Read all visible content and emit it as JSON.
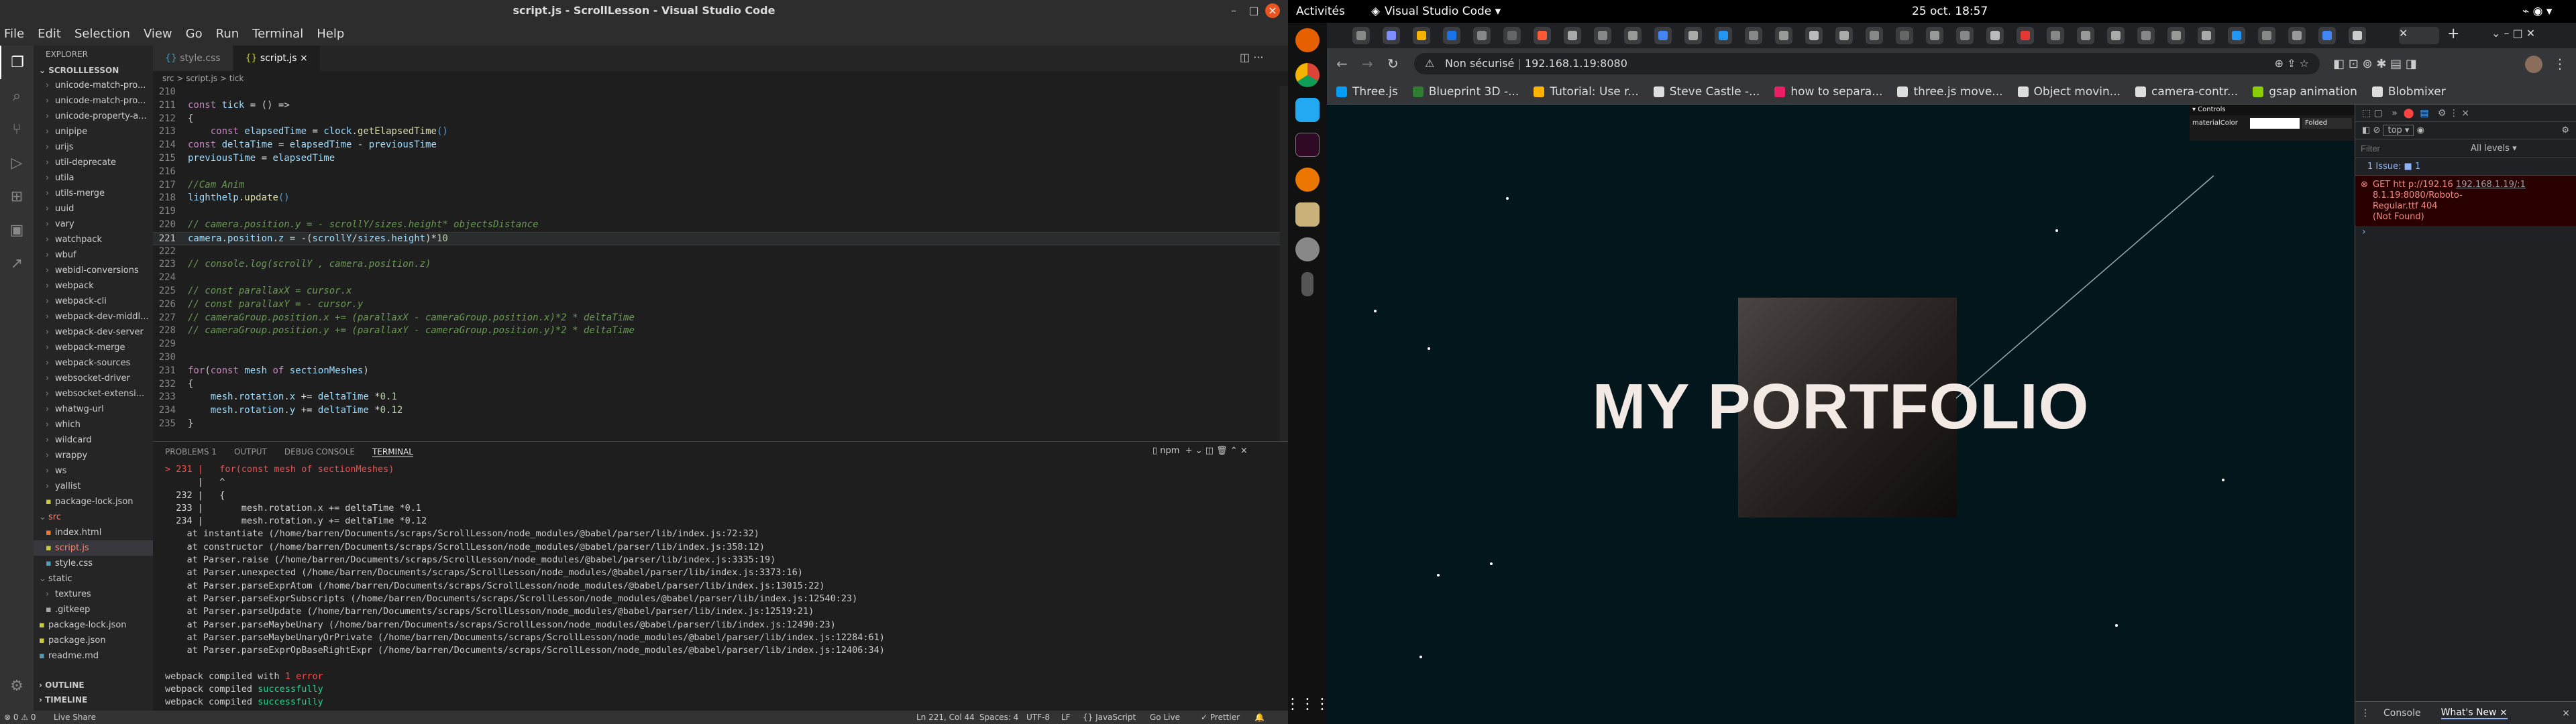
{
  "vscode": {
    "window_title": "script.js - ScrollLesson - Visual Studio Code",
    "menu": [
      "File",
      "Edit",
      "Selection",
      "View",
      "Go",
      "Run",
      "Terminal",
      "Help"
    ],
    "explorer": {
      "header": "EXPLORER",
      "project": "SCROLLLESSON",
      "tree": [
        {
          "t": "unicode-match-pro...",
          "d": 1
        },
        {
          "t": "unicode-match-pro...",
          "d": 1
        },
        {
          "t": "unicode-property-a...",
          "d": 1
        },
        {
          "t": "unipipe",
          "d": 1
        },
        {
          "t": "urijs",
          "d": 1
        },
        {
          "t": "util-deprecate",
          "d": 1
        },
        {
          "t": "utila",
          "d": 1
        },
        {
          "t": "utils-merge",
          "d": 1
        },
        {
          "t": "uuid",
          "d": 1
        },
        {
          "t": "vary",
          "d": 1
        },
        {
          "t": "watchpack",
          "d": 1
        },
        {
          "t": "wbuf",
          "d": 1
        },
        {
          "t": "webidl-conversions",
          "d": 1
        },
        {
          "t": "webpack",
          "d": 1
        },
        {
          "t": "webpack-cli",
          "d": 1
        },
        {
          "t": "webpack-dev-middl...",
          "d": 1
        },
        {
          "t": "webpack-dev-server",
          "d": 1
        },
        {
          "t": "webpack-merge",
          "d": 1
        },
        {
          "t": "webpack-sources",
          "d": 1
        },
        {
          "t": "websocket-driver",
          "d": 1
        },
        {
          "t": "websocket-extensi...",
          "d": 1
        },
        {
          "t": "whatwg-url",
          "d": 1
        },
        {
          "t": "which",
          "d": 1
        },
        {
          "t": "wildcard",
          "d": 1
        },
        {
          "t": "wrappy",
          "d": 1
        },
        {
          "t": "ws",
          "d": 1
        },
        {
          "t": "yallist",
          "d": 1
        },
        {
          "t": "package-lock.json",
          "d": 1,
          "f": "json"
        },
        {
          "t": "src",
          "d": 0,
          "red": true,
          "open": true
        },
        {
          "t": "index.html",
          "d": 1,
          "f": "html"
        },
        {
          "t": "script.js",
          "d": 1,
          "f": "js",
          "red": true,
          "sel": true
        },
        {
          "t": "style.css",
          "d": 1,
          "f": "css"
        },
        {
          "t": "static",
          "d": 0,
          "open": true
        },
        {
          "t": "textures",
          "d": 1
        },
        {
          "t": ".gitkeep",
          "d": 1,
          "f": "txt"
        },
        {
          "t": "package-lock.json",
          "d": 0,
          "f": "json"
        },
        {
          "t": "package.json",
          "d": 0,
          "f": "json"
        },
        {
          "t": "readme.md",
          "d": 0,
          "f": "md"
        }
      ],
      "outline": "OUTLINE",
      "timeline": "TIMELINE"
    },
    "tabs": [
      {
        "label": "style.css",
        "active": false
      },
      {
        "label": "script.js",
        "active": true
      }
    ],
    "breadcrumb": "src > script.js > tick",
    "code_start_line": 210,
    "code": [
      "",
      "const tick = () =>",
      "{",
      "    const elapsedTime = clock.getElapsedTime()",
      "const deltaTime = elapsedTime - previousTime",
      "previousTime = elapsedTime",
      "",
      "//Cam Anim",
      "lighthelp.update()",
      "",
      "// camera.position.y = - scrollY/sizes.height* objectsDistance",
      "camera.position.z = -(scrollY/sizes.height)*10",
      "",
      "// console.log(scrollY , camera.position.z)",
      "",
      "// const parallaxX = cursor.x",
      "// const parallaxY = - cursor.y",
      "// cameraGroup.position.x += (parallaxX - cameraGroup.position.x)*2 * deltaTime",
      "// cameraGroup.position.y += (parallaxY - cameraGroup.position.y)*2 * deltaTime",
      "",
      "",
      "for(const mesh of sectionMeshes)",
      "{",
      "    mesh.rotation.x += deltaTime *0.1",
      "    mesh.rotation.y += deltaTime *0.12",
      "}"
    ],
    "current_line": 221,
    "panel_tabs": [
      "PROBLEMS 1",
      "OUTPUT",
      "DEBUG CONSOLE",
      "TERMINAL"
    ],
    "terminal_shell": "npm",
    "terminal": [
      "> 231 |   for(const mesh of sectionMeshes)",
      "      |   ^",
      "  232 |   {",
      "  233 |       mesh.rotation.x += deltaTime *0.1",
      "  234 |       mesh.rotation.y += deltaTime *0.12",
      "    at instantiate (/home/barren/Documents/scraps/ScrollLesson/node_modules/@babel/parser/lib/index.js:72:32)",
      "    at constructor (/home/barren/Documents/scraps/ScrollLesson/node_modules/@babel/parser/lib/index.js:358:12)",
      "    at Parser.raise (/home/barren/Documents/scraps/ScrollLesson/node_modules/@babel/parser/lib/index.js:3335:19)",
      "    at Parser.unexpected (/home/barren/Documents/scraps/ScrollLesson/node_modules/@babel/parser/lib/index.js:3373:16)",
      "    at Parser.parseExprAtom (/home/barren/Documents/scraps/ScrollLesson/node_modules/@babel/parser/lib/index.js:13015:22)",
      "    at Parser.parseExprSubscripts (/home/barren/Documents/scraps/ScrollLesson/node_modules/@babel/parser/lib/index.js:12540:23)",
      "    at Parser.parseUpdate (/home/barren/Documents/scraps/ScrollLesson/node_modules/@babel/parser/lib/index.js:12519:21)",
      "    at Parser.parseMaybeUnary (/home/barren/Documents/scraps/ScrollLesson/node_modules/@babel/parser/lib/index.js:12490:23)",
      "    at Parser.parseMaybeUnaryOrPrivate (/home/barren/Documents/scraps/ScrollLesson/node_modules/@babel/parser/lib/index.js:12284:61)",
      "    at Parser.parseExprOpBaseRightExpr (/home/barren/Documents/scraps/ScrollLesson/node_modules/@babel/parser/lib/index.js:12406:34)",
      "",
      "webpack compiled with 1 error",
      "webpack compiled successfully",
      "webpack compiled successfully"
    ],
    "status": {
      "live_share": "Live Share",
      "position": "Ln 221, Col 44",
      "spaces": "Spaces: 4",
      "encoding": "UTF-8",
      "eol": "LF",
      "lang": "{} JavaScript",
      "golive": "Go Live",
      "prettier": "✓ Prettier"
    }
  },
  "gnome": {
    "activities": "Activités",
    "app": "Visual Studio Code ▾",
    "clock": "25 oct.  18:57"
  },
  "chrome": {
    "not_secure": "Non sécurisé",
    "url": "192.168.1.19:8080",
    "bookmarks": [
      "Three.js",
      "Blueprint 3D -...",
      "Tutorial: Use r...",
      "Steve Castle -...",
      "how to separa...",
      "three.js move...",
      "Object movin...",
      "camera-contr...",
      "gsap animation",
      "Blobmixer"
    ],
    "page_heading": "MY PORTFOLIO",
    "gui": {
      "title": "▾ Controls",
      "label": "materialColor",
      "button": "Folded"
    },
    "devtools": {
      "context": "top",
      "filter_placeholder": "Filter",
      "levels": "All levels ▾",
      "issues": "1 Issue: ■ 1",
      "error_link": "192.168.1.19/:1",
      "error_text": "GET htt p://192.16 8.1.19:8080/Roboto-Regular.ttf 404 (Not Found)",
      "drawer_tabs": [
        "Console",
        "What's New ×"
      ]
    }
  },
  "colors": {
    "accent": "#007acc",
    "error": "#f48771",
    "page_bg": "#03161b"
  }
}
